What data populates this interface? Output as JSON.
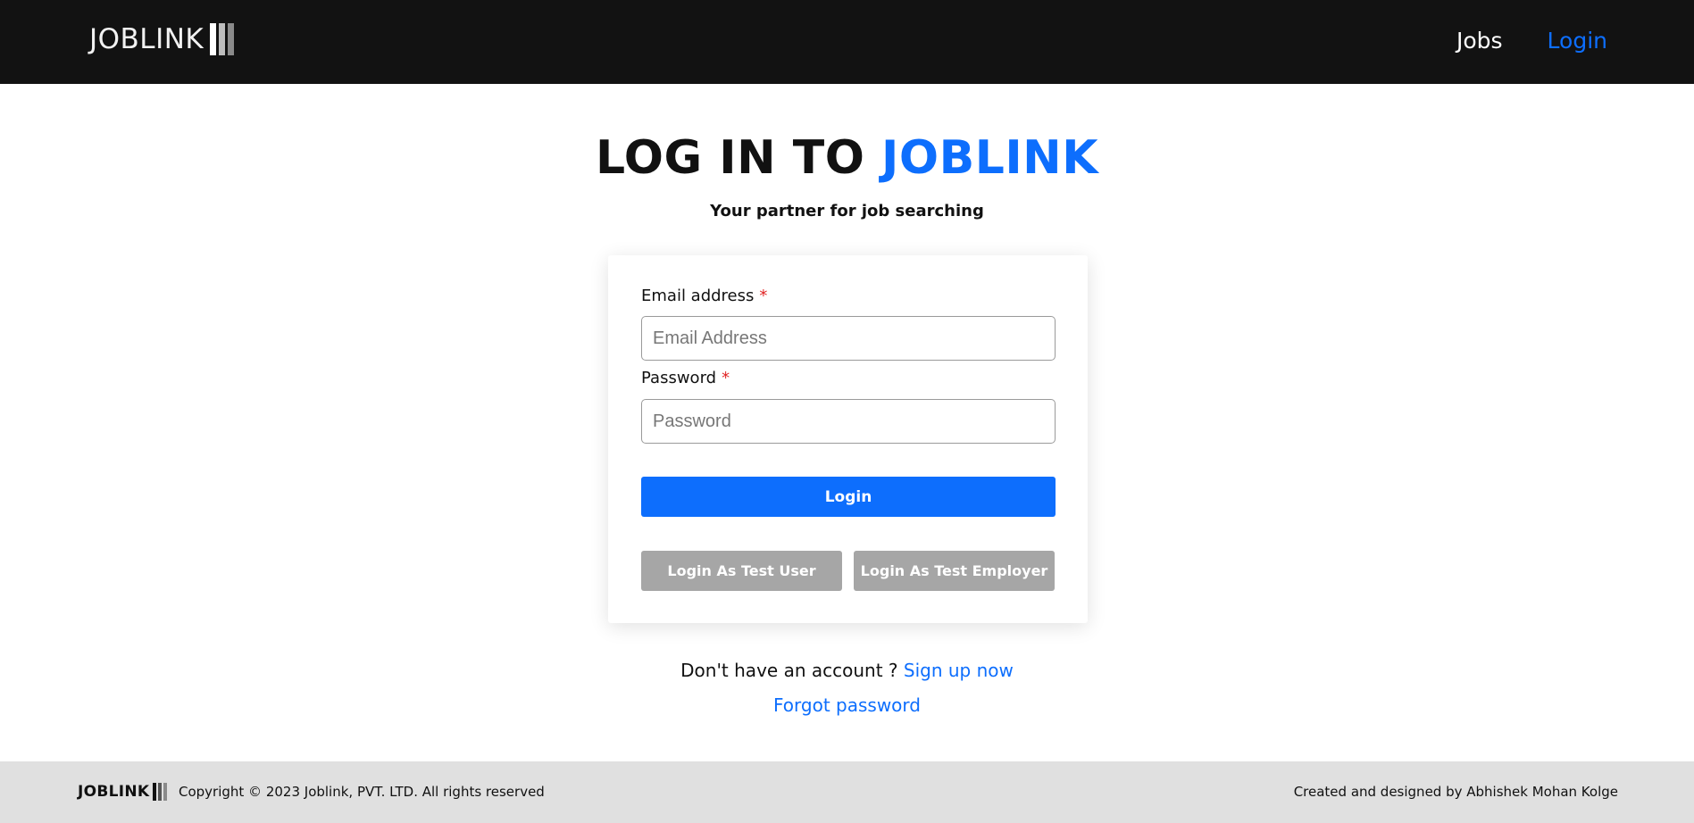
{
  "colors": {
    "accent": "#0d6efd",
    "header_bg": "#121212",
    "footer_bg": "#e0e0e0",
    "secondary_button": "#a6a6a6",
    "required": "#e02424",
    "logo_bars": [
      "#ffffff",
      "#bdbdbd",
      "#8a8a8a"
    ]
  },
  "header": {
    "logo_text": "JOBLINK",
    "nav": {
      "jobs": "Jobs",
      "login": "Login"
    }
  },
  "main": {
    "title_prefix": "LOG IN TO ",
    "title_brand": "JOBLINK",
    "subtitle": "Your partner for job searching"
  },
  "form": {
    "email": {
      "label": "Email address",
      "required_mark": "*",
      "placeholder": "Email Address",
      "value": ""
    },
    "password": {
      "label": "Password",
      "required_mark": "*",
      "placeholder": "Password",
      "value": ""
    },
    "login_button": "Login",
    "test_user_button": "Login As Test User",
    "test_employer_button": "Login As Test Employer"
  },
  "links": {
    "no_account_text": "Don't have an account ? ",
    "signup": "Sign up now",
    "forgot_password": "Forgot password"
  },
  "footer": {
    "logo_text": "JOBLINK",
    "copyright": "Copyright © 2023 Joblink, PVT. LTD. All rights reserved",
    "credit": "Created and designed by Abhishek Mohan Kolge"
  }
}
